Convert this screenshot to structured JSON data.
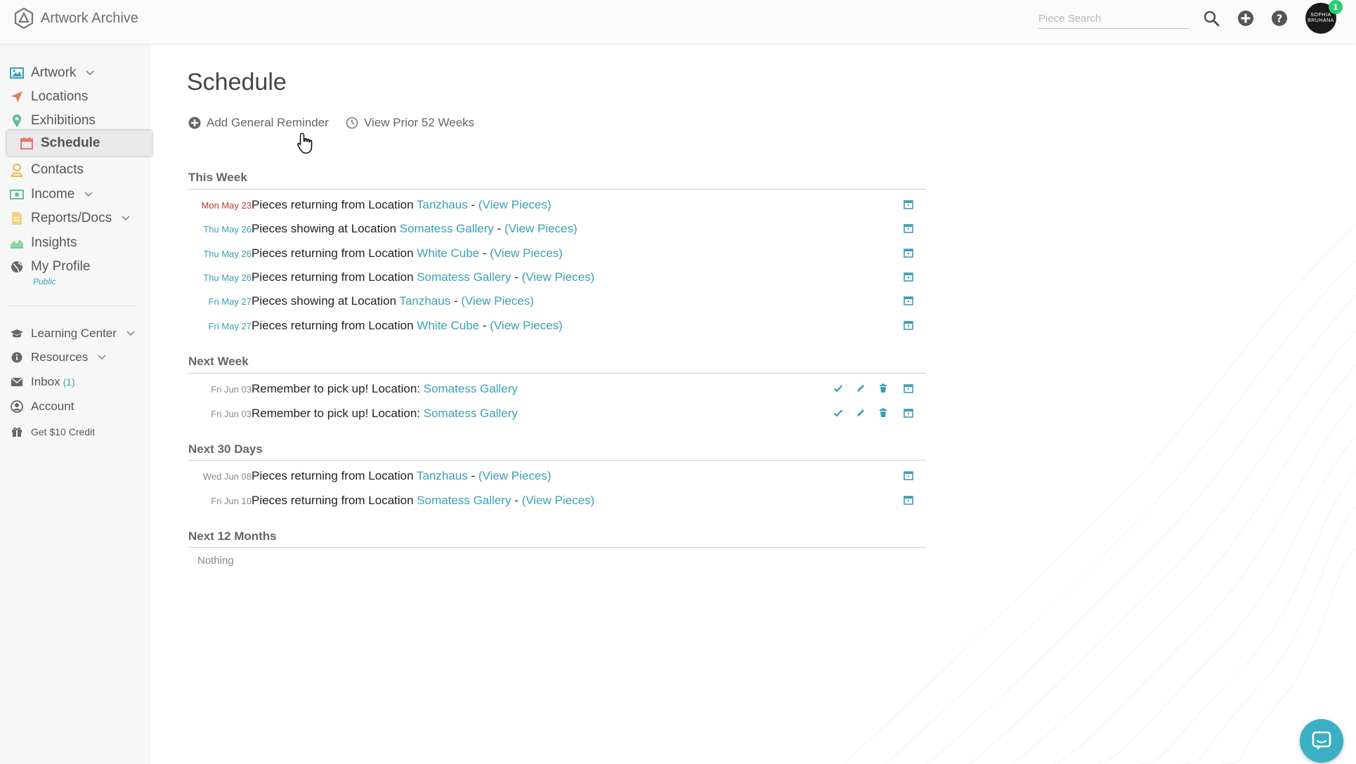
{
  "app": {
    "name": "Artwork Archive"
  },
  "header": {
    "search_placeholder": "Piece Search",
    "notification_count": "1",
    "avatar_text": "SOPHIA BRUHANA"
  },
  "sidebar": {
    "items": [
      {
        "label": "Artwork",
        "icon": "image-icon",
        "expandable": true
      },
      {
        "label": "Locations",
        "icon": "location-arrow-icon"
      },
      {
        "label": "Exhibitions",
        "icon": "map-pin-icon"
      },
      {
        "label": "Schedule",
        "icon": "calendar-icon",
        "active": true
      },
      {
        "label": "Contacts",
        "icon": "user-icon"
      },
      {
        "label": "Income",
        "icon": "money-icon",
        "expandable": true
      },
      {
        "label": "Reports/Docs",
        "icon": "document-icon",
        "expandable": true
      },
      {
        "label": "Insights",
        "icon": "area-chart-icon"
      },
      {
        "label": "My Profile",
        "icon": "globe-icon",
        "sub": "Public"
      }
    ],
    "secondary": [
      {
        "label": "Learning Center",
        "icon": "graduation-cap-icon",
        "expandable": true
      },
      {
        "label": "Resources",
        "icon": "info-icon",
        "expandable": true
      },
      {
        "label": "Inbox",
        "icon": "envelope-icon",
        "count": "(1)"
      },
      {
        "label": "Account",
        "icon": "user-circle-icon"
      },
      {
        "label": "Get $10 Credit",
        "icon": "gift-icon"
      }
    ]
  },
  "main": {
    "title": "Schedule",
    "actions": {
      "add_reminder": "Add General Reminder",
      "view_prior": "View Prior 52 Weeks"
    },
    "sections": [
      {
        "title": "This Week",
        "rows": [
          {
            "date": "Mon May 23",
            "prefix": "Pieces returning from Location ",
            "location": "Tanzhaus",
            "sep": " - ",
            "link": "(View Pieces)"
          },
          {
            "date": "Thu May 26",
            "prefix": "Pieces showing at Location ",
            "location": "Somatess Gallery",
            "sep": " - ",
            "link": "(View Pieces)"
          },
          {
            "date": "Thu May 26",
            "prefix": "Pieces returning from Location ",
            "location": "White Cube",
            "sep": " - ",
            "link": "(View Pieces)"
          },
          {
            "date": "Thu May 26",
            "prefix": "Pieces returning from Location ",
            "location": "Somatess Gallery",
            "sep": " - ",
            "link": "(View Pieces)"
          },
          {
            "date": "Fri May 27",
            "prefix": "Pieces showing at Location ",
            "location": "Tanzhaus",
            "sep": " - ",
            "link": "(View Pieces)"
          },
          {
            "date": "Fri May 27",
            "prefix": "Pieces returning from Location ",
            "location": "White Cube",
            "sep": " - ",
            "link": "(View Pieces)"
          }
        ]
      },
      {
        "title": "Next Week",
        "rows": [
          {
            "date": "Fri Jun 03",
            "prefix": "Remember to pick up! Location: ",
            "location": "Somatess Gallery"
          },
          {
            "date": "Fri Jun 03",
            "prefix": "Remember to pick up! Location: ",
            "location": "Somatess Gallery"
          }
        ]
      },
      {
        "title": "Next 30 Days",
        "rows": [
          {
            "date": "Wed Jun 08",
            "prefix": "Pieces returning from Location ",
            "location": "Tanzhaus",
            "sep": " - ",
            "link": "(View Pieces)"
          },
          {
            "date": "Fri Jun 10",
            "prefix": "Pieces returning from Location ",
            "location": "Somatess Gallery",
            "sep": " - ",
            "link": "(View Pieces)"
          }
        ]
      },
      {
        "title": "Next 12 Months",
        "empty_text": "Nothing"
      }
    ]
  },
  "colors": {
    "accent": "#3aa0b5",
    "today": "#c0392b",
    "chat": "#3ab0c4"
  }
}
